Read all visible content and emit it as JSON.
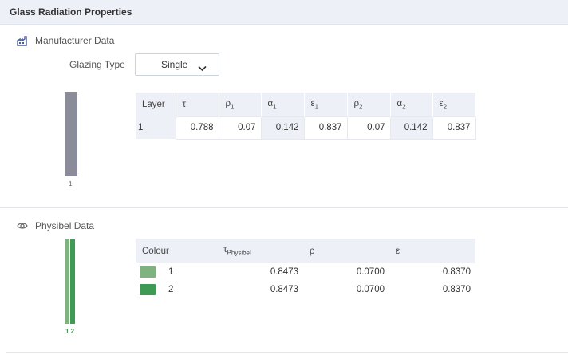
{
  "title": "Glass Radiation Properties",
  "manufacturer": {
    "section_label": "Manufacturer Data",
    "icon": "factory-icon",
    "glazing_type_label": "Glazing Type",
    "glazing_type_value": "Single",
    "glass_index_label": "1",
    "glass_color": "#8a8d99",
    "table": {
      "headers": {
        "layer": "Layer",
        "tau": "τ",
        "rho1": "ρ",
        "rho1_sub": "1",
        "alpha1": "α",
        "alpha1_sub": "1",
        "eps1": "ε",
        "eps1_sub": "1",
        "rho2": "ρ",
        "rho2_sub": "2",
        "alpha2": "α",
        "alpha2_sub": "2",
        "eps2": "ε",
        "eps2_sub": "2"
      },
      "rows": [
        {
          "layer": "1",
          "tau": "0.788",
          "rho1": "0.07",
          "alpha1": "0.142",
          "eps1": "0.837",
          "rho2": "0.07",
          "alpha2": "0.142",
          "eps2": "0.837"
        }
      ]
    }
  },
  "physibel": {
    "section_label": "Physibel Data",
    "icon": "eye-icon",
    "glass_index_label": "1 2",
    "table": {
      "headers": {
        "colour": "Colour",
        "tau": "τ",
        "tau_sub": "Physibel",
        "rho": "ρ",
        "eps": "ε"
      },
      "rows": [
        {
          "colour_index": "1",
          "color": "#7fb27f",
          "tau": "0.8473",
          "rho": "0.0700",
          "eps": "0.8370"
        },
        {
          "colour_index": "2",
          "color": "#3f9a55",
          "tau": "0.8473",
          "rho": "0.0700",
          "eps": "0.8370"
        }
      ]
    }
  }
}
